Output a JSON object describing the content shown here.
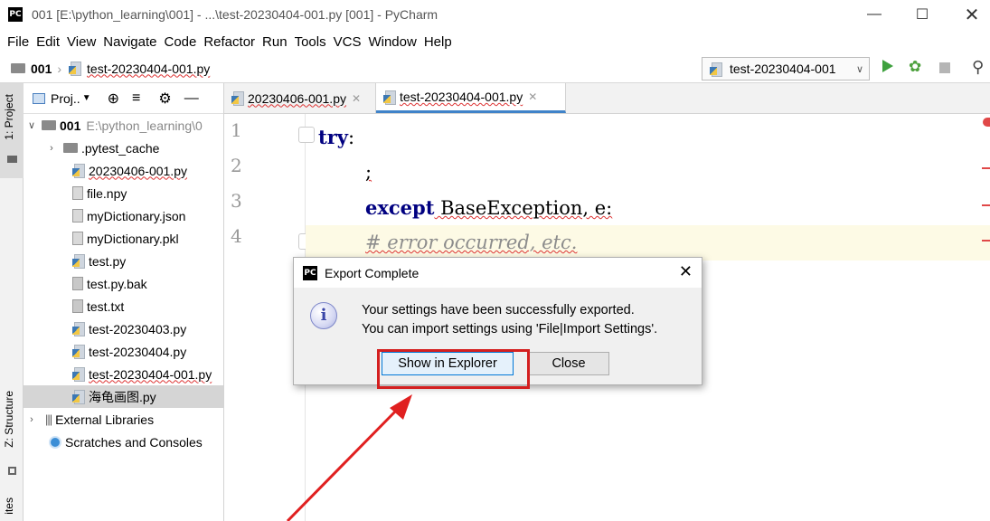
{
  "window": {
    "title": "001 [E:\\python_learning\\001] - ...\\test-20230404-001.py [001] - PyCharm",
    "logo": "PC"
  },
  "menu": [
    "File",
    "Edit",
    "View",
    "Navigate",
    "Code",
    "Refactor",
    "Run",
    "Tools",
    "VCS",
    "Window",
    "Help"
  ],
  "navbar": {
    "project": "001",
    "file": "test-20230404-001.py",
    "run_config": "test-20230404-001"
  },
  "side_tabs": {
    "project": "1: Project",
    "structure": "Z: Structure",
    "favorites": "ites"
  },
  "project_panel": {
    "label": "Proj..",
    "root_name": "001",
    "root_path": "E:\\python_learning\\0",
    "items": [
      {
        "name": ".pytest_cache",
        "type": "folder"
      },
      {
        "name": "20230406-001.py",
        "type": "py"
      },
      {
        "name": "file.npy",
        "type": "file"
      },
      {
        "name": "myDictionary.json",
        "type": "file"
      },
      {
        "name": "myDictionary.pkl",
        "type": "file"
      },
      {
        "name": "test.py",
        "type": "py"
      },
      {
        "name": "test.py.bak",
        "type": "txt"
      },
      {
        "name": "test.txt",
        "type": "txt"
      },
      {
        "name": "test-20230403.py",
        "type": "py"
      },
      {
        "name": "test-20230404.py",
        "type": "py"
      },
      {
        "name": "test-20230404-001.py",
        "type": "py"
      },
      {
        "name": "海龟画图.py",
        "type": "py"
      }
    ],
    "external": "External Libraries",
    "scratches": "Scratches and Consoles"
  },
  "editor": {
    "tabs": [
      {
        "label": "20230406-001.py",
        "active": false
      },
      {
        "label": "test-20230404-001.py",
        "active": true
      }
    ],
    "line_numbers": [
      "1",
      "2",
      "3",
      "4"
    ],
    "lines": {
      "l1_kw": "try",
      "l1_rest": ":",
      "l2": ";",
      "l3_kw": "except",
      "l3_rest": " BaseException, e:",
      "l4": "# error occurred, etc."
    }
  },
  "dialog": {
    "title": "Export Complete",
    "message_line1": "Your settings have been successfully exported.",
    "message_line2": "You can import settings using 'File|Import Settings'.",
    "show_button": "Show in Explorer",
    "close_button": "Close",
    "info_glyph": "i"
  },
  "colors": {
    "highlight": "#d41f1f",
    "keyword": "#000080",
    "comment": "#8c8c8c"
  }
}
